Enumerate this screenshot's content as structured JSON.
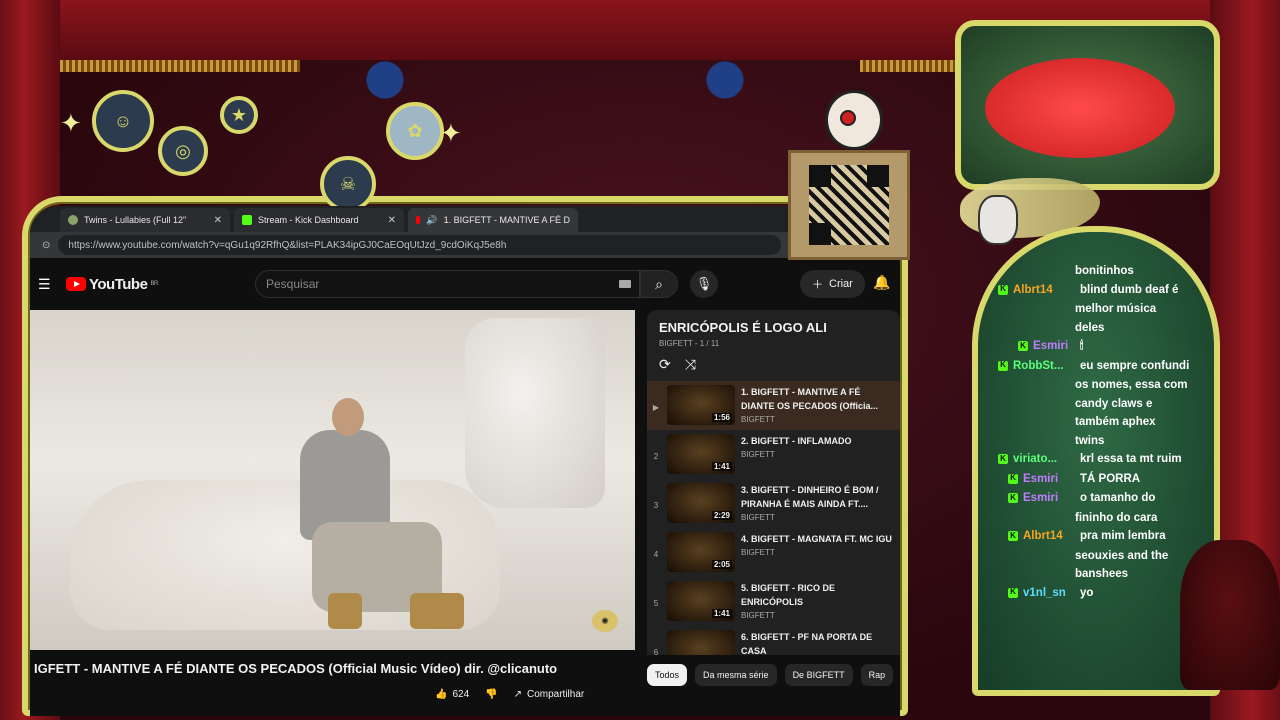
{
  "browser": {
    "tabs": [
      {
        "label": "Twins - Lullabies (Full 12\"",
        "icon": "twins-avatar-icon"
      },
      {
        "label": "Stream - Kick Dashboard",
        "icon": "kick-icon"
      },
      {
        "label": "1. BIGFETT - MANTIVE A FÉ D",
        "icon": "youtube-icon"
      }
    ],
    "url": "https://www.youtube.com/watch?v=qGu1q92RfhQ&list=PLAK34ipGJ0CaEOqUtJzd_9cdOiKqJ5e8h"
  },
  "youtube": {
    "logo_text": "YouTube",
    "region": "BR",
    "search_placeholder": "Pesquisar",
    "create_label": "Criar",
    "video_title": "IGFETT - MANTIVE A FÉ DIANTE OS PECADOS (Official Music Vídeo) dir. @clicanuto",
    "likes": "624",
    "share_label": "Compartilhar"
  },
  "playlist": {
    "title": "ENRICÓPOLIS É LOGO ALI",
    "subtitle": "BIGFETT - 1 / 11",
    "items": [
      {
        "index": "▶",
        "title": "1. BIGFETT - MANTIVE A FÉ DIANTE OS PECADOS (Officia...",
        "channel": "BIGFETT",
        "duration": "1:56"
      },
      {
        "index": "2",
        "title": "2. BIGFETT - INFLAMADO",
        "channel": "BIGFETT",
        "duration": "1:41"
      },
      {
        "index": "3",
        "title": "3. BIGFETT - DINHEIRO É BOM / PIRANHA É MAIS AINDA FT....",
        "channel": "BIGFETT",
        "duration": "2:29"
      },
      {
        "index": "4",
        "title": "4. BIGFETT - MAGNATA FT. MC IGU",
        "channel": "BIGFETT",
        "duration": "2:05"
      },
      {
        "index": "5",
        "title": "5. BIGFETT - RICO DE ENRICÓPOLIS",
        "channel": "BIGFETT",
        "duration": "1:41"
      },
      {
        "index": "6",
        "title": "6. BIGFETT - PF NA PORTA DE CASA",
        "channel": "BIGFETT",
        "duration": ""
      }
    ],
    "chips": [
      "Todos",
      "Da mesma série",
      "De BIGFETT",
      "Rap"
    ]
  },
  "chat": {
    "lead": "bonitinhos",
    "messages": [
      {
        "user": "Albrt14",
        "color": "#f5a623",
        "lines": [
          "blind dumb deaf é",
          "melhor música",
          "deles"
        ]
      },
      {
        "user": "Esmiri",
        "color": "#c07cff",
        "lines": [
          "🕯"
        ]
      },
      {
        "user": "RobbSt...",
        "color": "#5cff7a",
        "lines": [
          "eu sempre confundi",
          "os nomes, essa com",
          "candy claws e",
          "também aphex",
          "twins"
        ]
      },
      {
        "user": "viriato...",
        "color": "#5cff7a",
        "lines": [
          "krl essa ta mt ruim"
        ]
      },
      {
        "user": "Esmiri",
        "color": "#c07cff",
        "lines": [
          "TÁ PORRA"
        ]
      },
      {
        "user": "Esmiri",
        "color": "#c07cff",
        "lines": [
          "o tamanho do",
          "fininho do cara"
        ]
      },
      {
        "user": "Albrt14",
        "color": "#f5a623",
        "lines": [
          "pra mim lembra",
          "seouxies and the",
          "banshees"
        ]
      },
      {
        "user": "v1nl_sn",
        "color": "#5cdcff",
        "lines": [
          "yo"
        ]
      }
    ]
  }
}
